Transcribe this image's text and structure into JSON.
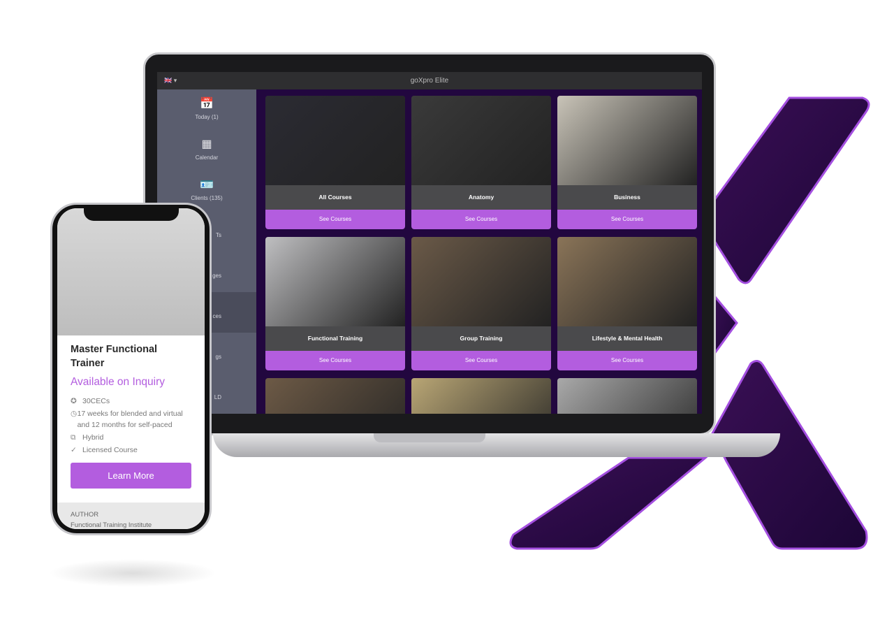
{
  "colors": {
    "accent": "#b35ddf",
    "brand_dark": "#2a0a4a"
  },
  "laptop": {
    "window_title": "goXpro Elite",
    "language_icon": "uk-flag-icon",
    "sidebar": [
      {
        "label": "Today (1)",
        "icon": "calendar-day-icon"
      },
      {
        "label": "Calendar",
        "icon": "calendar-icon"
      },
      {
        "label": "Clients (135)",
        "icon": "contact-card-icon"
      },
      {
        "label": "Ts",
        "icon": ""
      },
      {
        "label": "ges",
        "icon": ""
      },
      {
        "label": "ces",
        "icon": "",
        "active": true
      },
      {
        "label": "gs",
        "icon": ""
      },
      {
        "label": "LD",
        "icon": ""
      }
    ],
    "cards": [
      {
        "title": "All Courses",
        "button": "See Courses",
        "color": "#2b2b33"
      },
      {
        "title": "Anatomy",
        "button": "See Courses",
        "color": "#3a3a3a"
      },
      {
        "title": "Business",
        "button": "See Courses",
        "color": "#c9c4b8"
      },
      {
        "title": "Functional Training",
        "button": "See Courses",
        "color": "#bfbfc1"
      },
      {
        "title": "Group Training",
        "button": "See Courses",
        "color": "#6b5a48"
      },
      {
        "title": "Lifestyle & Mental Health",
        "button": "See Courses",
        "color": "#8a7458"
      },
      {
        "title": "",
        "button": "",
        "color": "#6d5a46"
      },
      {
        "title": "",
        "button": "",
        "color": "#b9a675"
      },
      {
        "title": "",
        "button": "",
        "color": "#a9a9a9"
      }
    ]
  },
  "phone": {
    "title": "Master Functional Trainer",
    "price": "Available on Inquiry",
    "details": [
      {
        "icon": "award-icon",
        "text": "30CECs"
      },
      {
        "icon": "clock-icon",
        "text": "17 weeks for blended and virtual and 12 months for self-paced"
      },
      {
        "icon": "devices-icon",
        "text": "Hybrid"
      },
      {
        "icon": "badge-check-icon",
        "text": "Licensed Course"
      }
    ],
    "button": "Learn More",
    "author_label": "AUTHOR",
    "author_name": "Functional Training Institute"
  }
}
